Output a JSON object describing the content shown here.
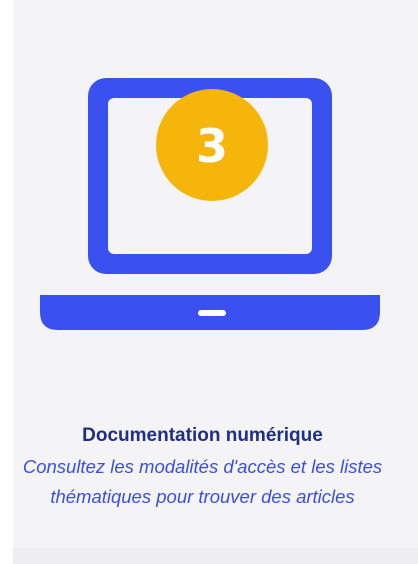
{
  "card": {
    "badge_number": "3",
    "title": "Documentation numérique",
    "description_line1": "Consultez les modalités d'accès et les listes",
    "description_line2": "thématiques pour trouver des articles",
    "icon": "laptop-icon"
  },
  "colors": {
    "laptop": "#3a50f0",
    "badge": "#f5b50a",
    "title": "#1f2f86",
    "description": "#3a4fe0",
    "card_background": "#f4f4f6"
  }
}
